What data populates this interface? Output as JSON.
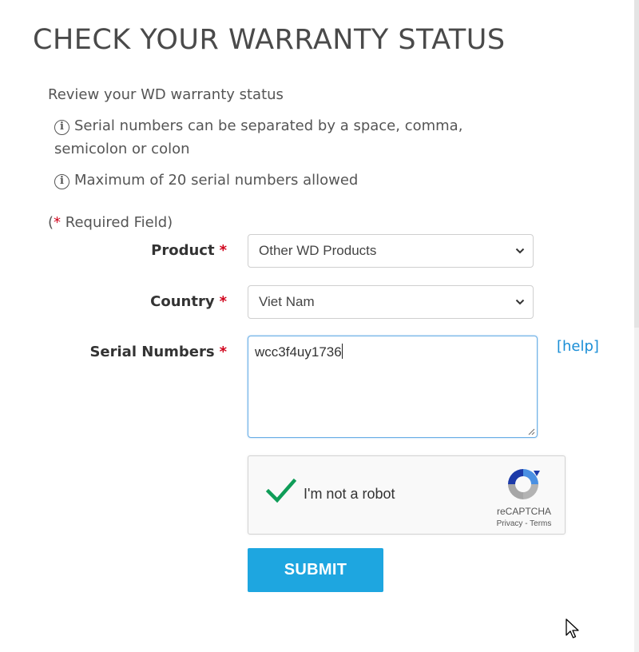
{
  "page": {
    "title": "CHECK YOUR WARRANTY STATUS",
    "intro": "Review your WD warranty status",
    "notes": [
      "Serial numbers can be separated by a space, comma, semicolon or colon",
      "Maximum of 20 serial numbers allowed"
    ],
    "required_open": "(",
    "required_star": "*",
    "required_text": " Required Field)"
  },
  "form": {
    "product": {
      "label": "Product",
      "star": "*",
      "value": "Other WD Products"
    },
    "country": {
      "label": "Country",
      "star": "*",
      "value": "Viet Nam"
    },
    "serial": {
      "label": "Serial Numbers",
      "star": "*",
      "value": "wcc3f4uy1736"
    },
    "help_label": "[help]",
    "submit_label": "SUBMIT"
  },
  "captcha": {
    "label": "I'm not a robot",
    "brand": "reCAPTCHA",
    "privacy": "Privacy",
    "separator": " - ",
    "terms": "Terms",
    "checked": true
  },
  "colors": {
    "accent": "#1ea6e0",
    "required": "#d0021b",
    "link": "#1a8ed6",
    "check": "#0f9d58"
  },
  "icons": {
    "info": "info-circle-icon",
    "dropdown": "chevron-down-icon",
    "captcha_check": "checkmark-icon",
    "captcha_logo": "recaptcha-logo-icon",
    "cursor": "mouse-pointer-icon"
  }
}
